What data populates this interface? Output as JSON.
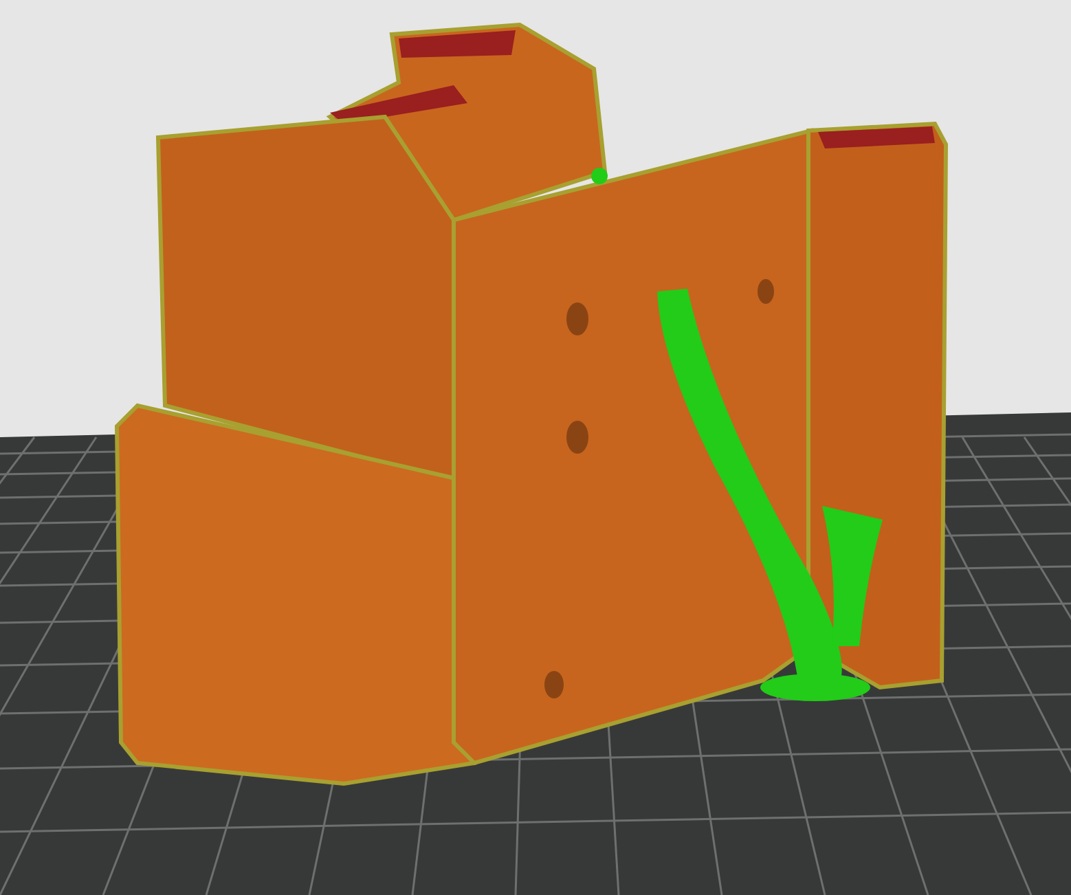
{
  "scene": {
    "objects": [
      {
        "kind": "bed"
      },
      {
        "kind": "part"
      },
      {
        "kind": "support"
      }
    ]
  }
}
